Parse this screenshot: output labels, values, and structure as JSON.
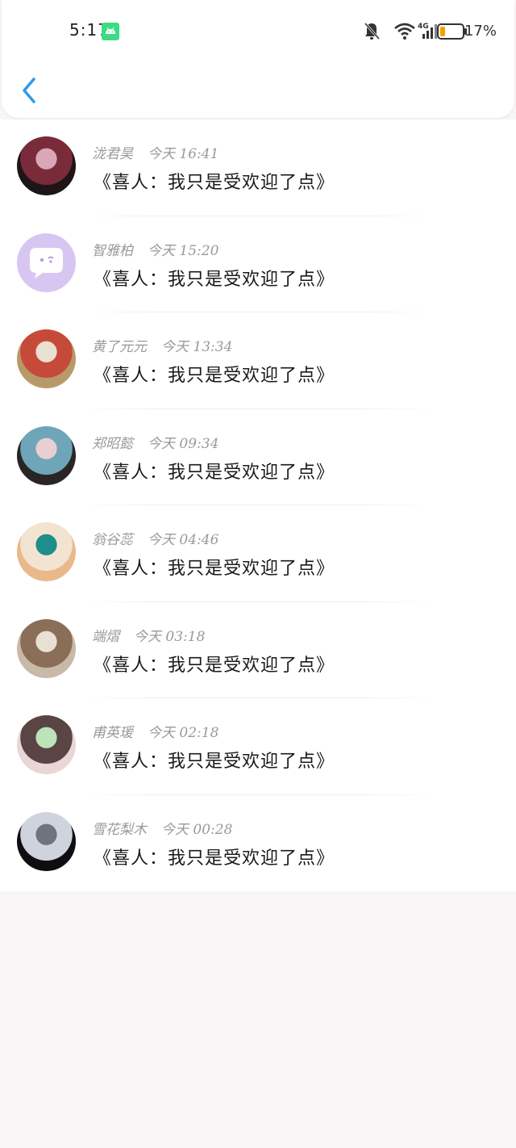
{
  "status_bar": {
    "time": "5:17",
    "network": "4G",
    "battery": "17%"
  },
  "header": {
    "back_icon": "chevron-left-icon",
    "accent_color": "#2f9be8"
  },
  "list": [
    {
      "name": "泷君昊",
      "time": "今天 16:41",
      "message": "《喜人：我只是受欢迎了点》",
      "avatar_colors": [
        "#1d1518",
        "#7a2b3a",
        "#d9a7b5"
      ]
    },
    {
      "name": "智雅柏",
      "time": "今天 15:20",
      "message": "《喜人：我只是受欢迎了点》",
      "avatar_colors": [
        "#d8c6f2",
        "#d8c6f2",
        "#ffffff"
      ]
    },
    {
      "name": "黄了元元",
      "time": "今天 13:34",
      "message": "《喜人：我只是受欢迎了点》",
      "avatar_colors": [
        "#b89a6a",
        "#c64a3a",
        "#e9e1cf"
      ]
    },
    {
      "name": "郑昭懿",
      "time": "今天 09:34",
      "message": "《喜人：我只是受欢迎了点》",
      "avatar_colors": [
        "#2a2424",
        "#6fa5b8",
        "#e8cfd2"
      ]
    },
    {
      "name": "翁谷蕊",
      "time": "今天 04:46",
      "message": "《喜人：我只是受欢迎了点》",
      "avatar_colors": [
        "#e9b98a",
        "#f3e3d1",
        "#1f8d8a"
      ]
    },
    {
      "name": "端熠",
      "time": "今天 03:18",
      "message": "《喜人：我只是受欢迎了点》",
      "avatar_colors": [
        "#c9b9a8",
        "#8a6e58",
        "#e9e0d4"
      ]
    },
    {
      "name": "甫英瑗",
      "time": "今天 02:18",
      "message": "《喜人：我只是受欢迎了点》",
      "avatar_colors": [
        "#e9d6d6",
        "#5a4444",
        "#bde3b8"
      ]
    },
    {
      "name": "雪花梨木",
      "time": "今天 00:28",
      "message": "《喜人：我只是受欢迎了点》",
      "avatar_colors": [
        "#0e0e12",
        "#cfd3dc",
        "#6e7380"
      ]
    }
  ]
}
